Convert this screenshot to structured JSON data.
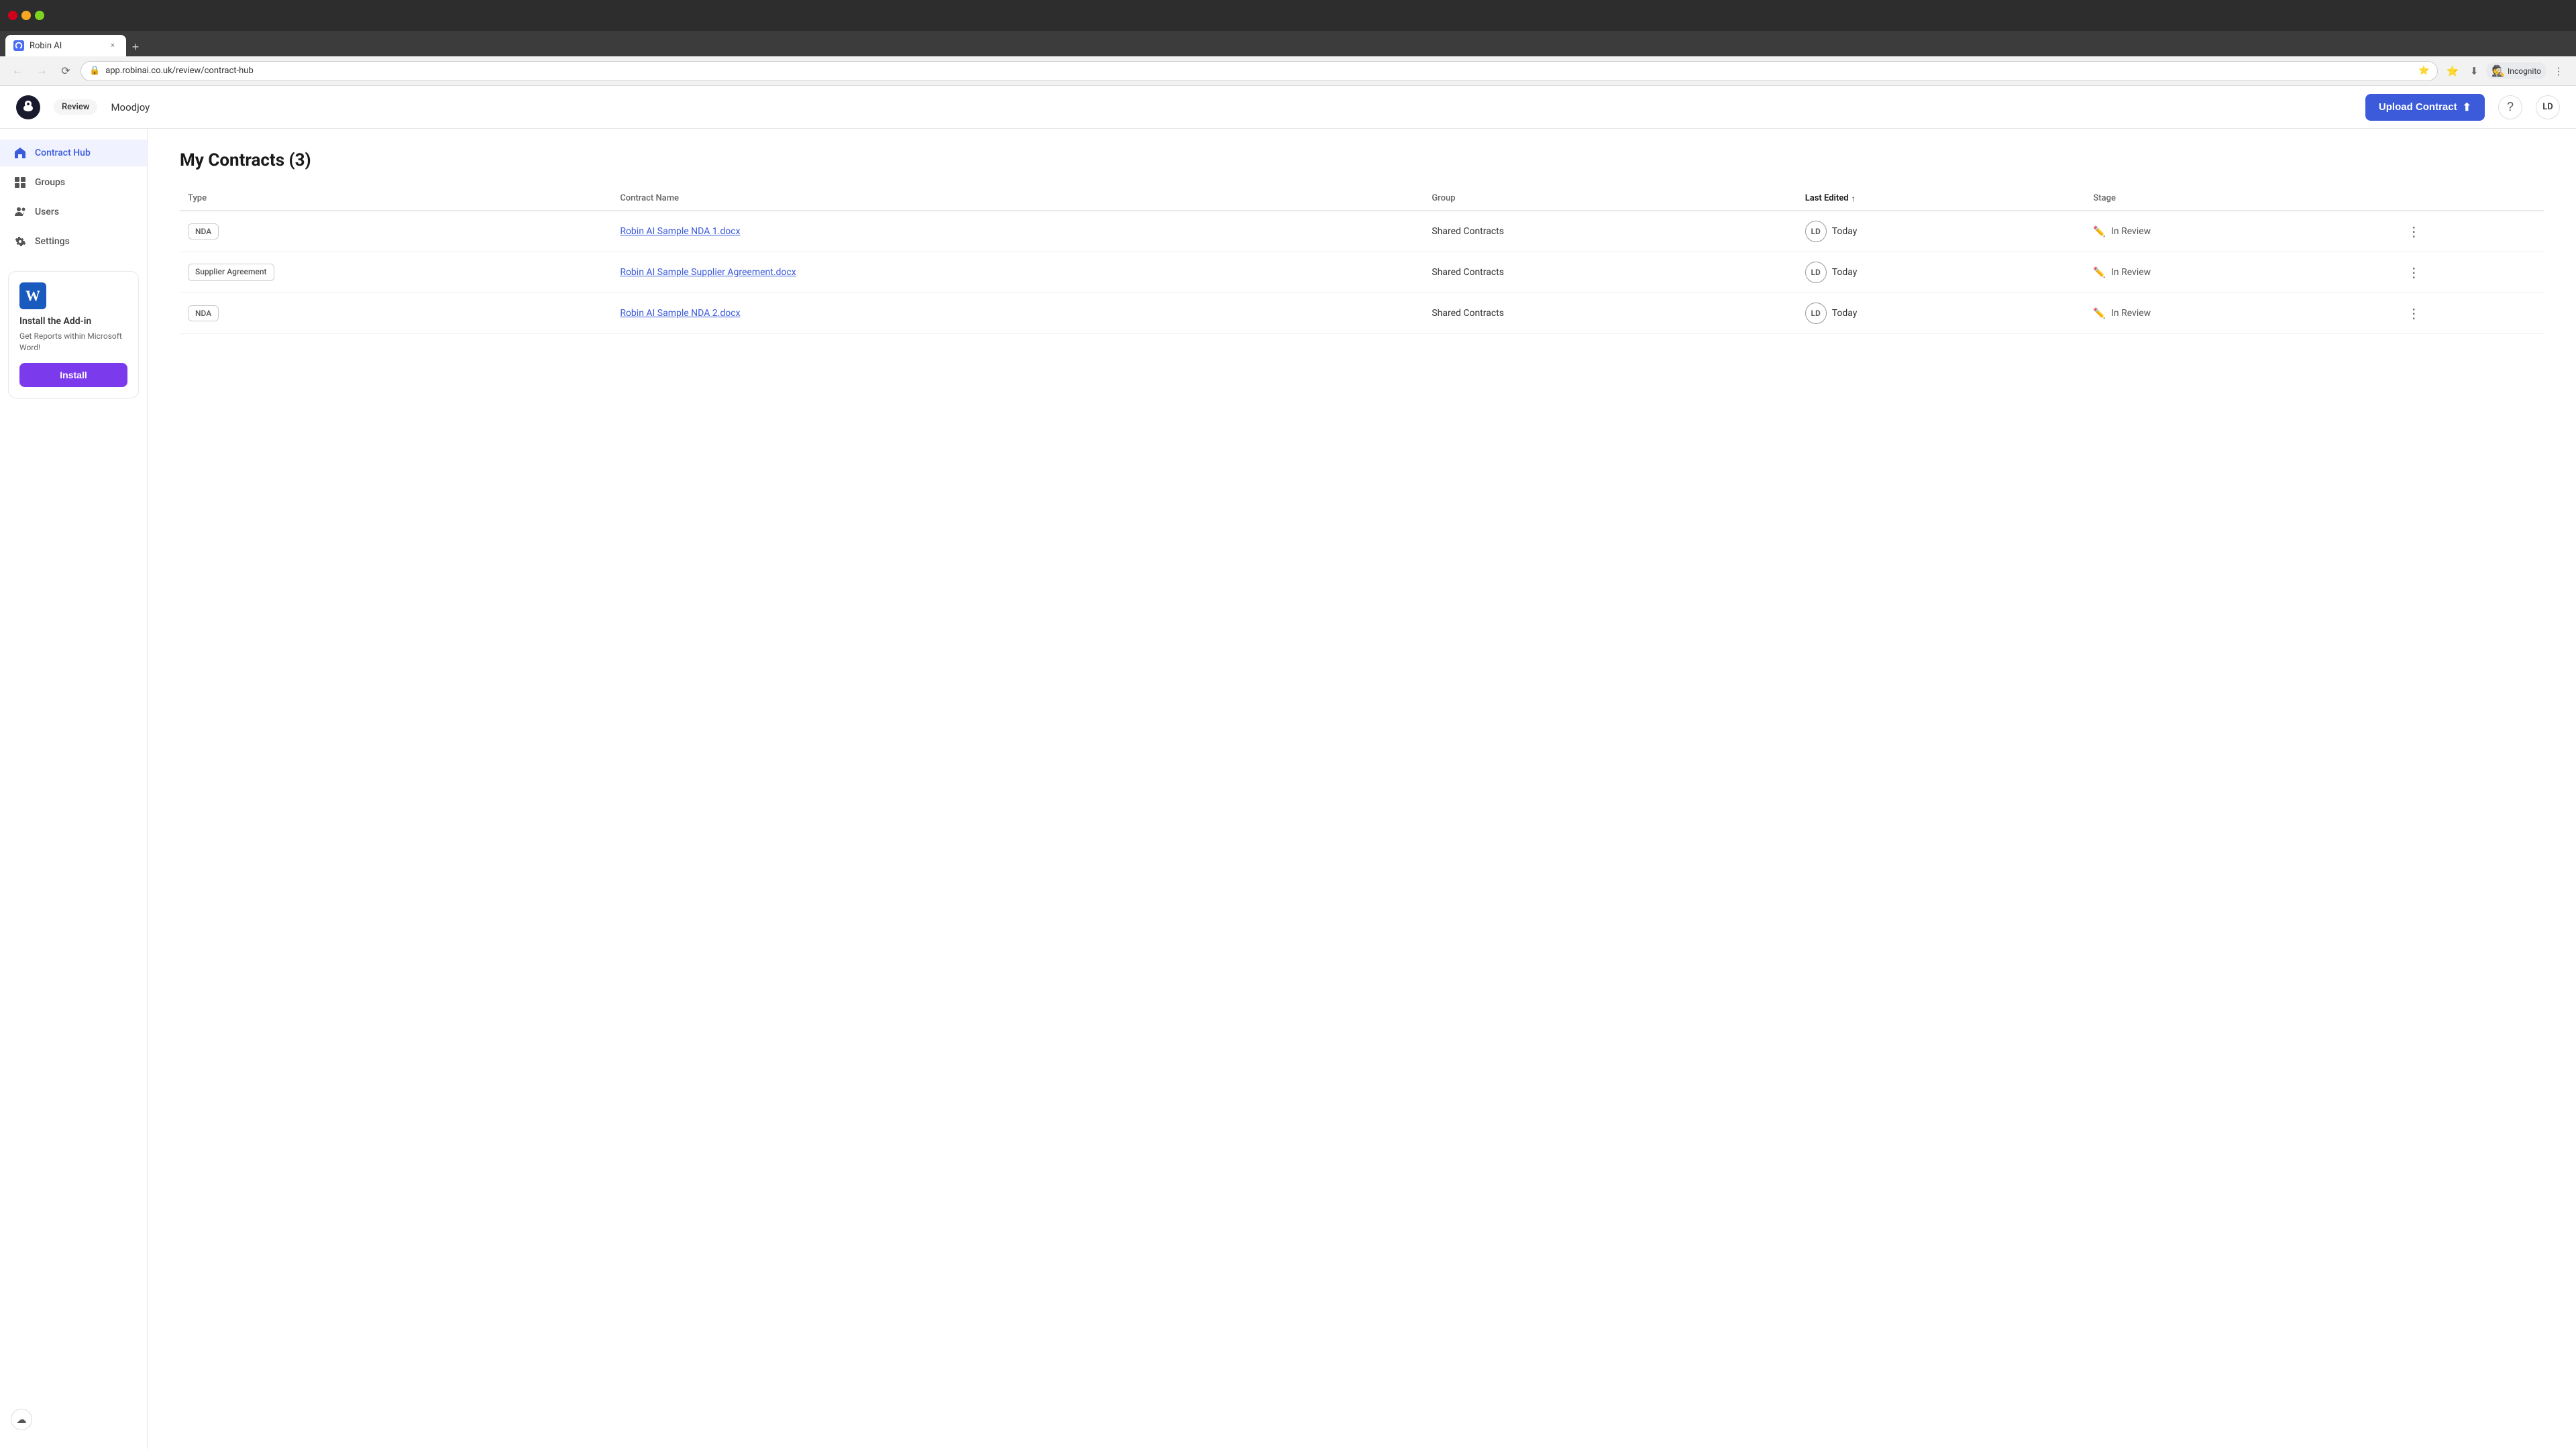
{
  "browser": {
    "tab_label": "Robin AI",
    "tab_favicon": "🐦",
    "address": "app.robinai.co.uk/review/contract-hub",
    "incognito_label": "Incognito",
    "new_tab_label": "+",
    "close_tab": "×"
  },
  "header": {
    "review_label": "Review",
    "company_name": "Moodjoy",
    "upload_button_label": "Upload Contract",
    "help_icon": "?",
    "user_initials": "LD"
  },
  "sidebar": {
    "items": [
      {
        "id": "contract-hub",
        "label": "Contract Hub",
        "active": true
      },
      {
        "id": "groups",
        "label": "Groups",
        "active": false
      },
      {
        "id": "users",
        "label": "Users",
        "active": false
      },
      {
        "id": "settings",
        "label": "Settings",
        "active": false
      }
    ],
    "addon": {
      "title": "Install the Add-in",
      "description": "Get Reports within Microsoft Word!",
      "install_button_label": "Install"
    }
  },
  "main": {
    "page_title": "My Contracts (3)",
    "table": {
      "columns": [
        "Type",
        "Contract Name",
        "Group",
        "Last Edited",
        "Stage"
      ],
      "rows": [
        {
          "type": "NDA",
          "type_multiline": false,
          "contract_name": "Robin AI Sample NDA 1.docx",
          "group": "Shared Contracts",
          "user_initials": "LD",
          "last_edited": "Today",
          "stage": "In Review"
        },
        {
          "type": "Supplier Agreement",
          "type_multiline": true,
          "contract_name": "Robin AI Sample Supplier Agreement.docx",
          "group": "Shared Contracts",
          "user_initials": "LD",
          "last_edited": "Today",
          "stage": "In Review"
        },
        {
          "type": "NDA",
          "type_multiline": false,
          "contract_name": "Robin AI Sample NDA 2.docx",
          "group": "Shared Contracts",
          "user_initials": "LD",
          "last_edited": "Today",
          "stage": "In Review"
        }
      ]
    }
  },
  "colors": {
    "accent": "#3b5bdb",
    "install_btn": "#7c3aed",
    "link": "#3b5bdb"
  }
}
